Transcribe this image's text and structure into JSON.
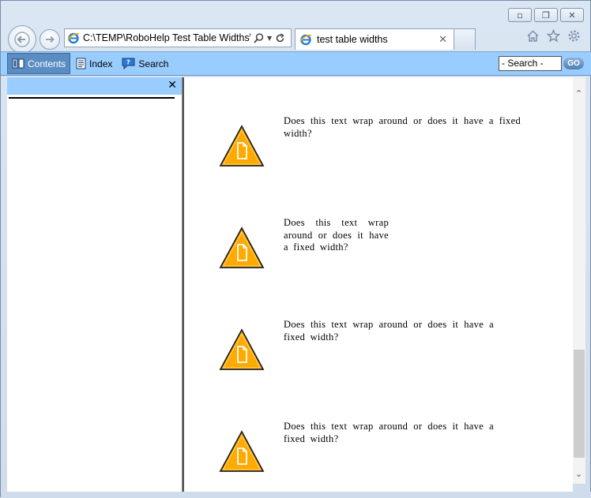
{
  "window": {
    "caption_buttons": [
      "minimize-icon",
      "restore-icon",
      "close-icon"
    ]
  },
  "browser": {
    "address_url": "C:\\TEMP\\RoboHelp Test Table Widths\\t",
    "tab_title": "test table widths",
    "right_icons": [
      "home-icon",
      "favorites-star-icon",
      "gear-icon"
    ]
  },
  "toolbar": {
    "contents_label": "Contents",
    "index_label": "Index",
    "search_label": "Search",
    "search_value": "- Search -",
    "go_label": "GO"
  },
  "colors": {
    "toolbar_bg": "#99ccff",
    "active_tab": "#5b8cc2",
    "warning_fill": "#ffaa00"
  },
  "content": {
    "entries": [
      {
        "lines": [
          "Does this text wrap around or does it have a fixed",
          "width?"
        ]
      },
      {
        "lines": [
          "Does this text wrap",
          "around or does it have",
          "a fixed width?"
        ]
      },
      {
        "lines": [
          "Does this text wrap around or does it have a",
          "fixed width?"
        ]
      },
      {
        "lines": [
          "Does this text wrap around or does it have a",
          "fixed width?"
        ]
      }
    ]
  }
}
